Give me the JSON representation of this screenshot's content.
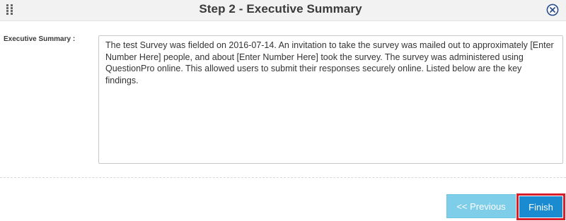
{
  "dialog": {
    "title": "Step 2 - Executive Summary",
    "icons": {
      "drag": "drag-handle-icon",
      "close": "close-circle-icon"
    }
  },
  "form": {
    "summary_label": "Executive Summary :",
    "summary_text": "The test Survey was fielded on 2016-07-14. An invitation to take the survey was mailed out to approximately [Enter Number Here] people, and about [Enter Number Here] took the survey. The survey was administered using QuestionPro online. This allowed users to submit their responses securely online. Listed below are the key findings."
  },
  "footer": {
    "previous_label": "<< Previous",
    "finish_label": "Finish"
  },
  "colors": {
    "header_bg": "#f2f2f2",
    "close_icon": "#2a4d8f",
    "previous_bg": "#7ecde9",
    "finish_bg": "#1a8bd0",
    "highlight_outline": "#d81e2a"
  }
}
